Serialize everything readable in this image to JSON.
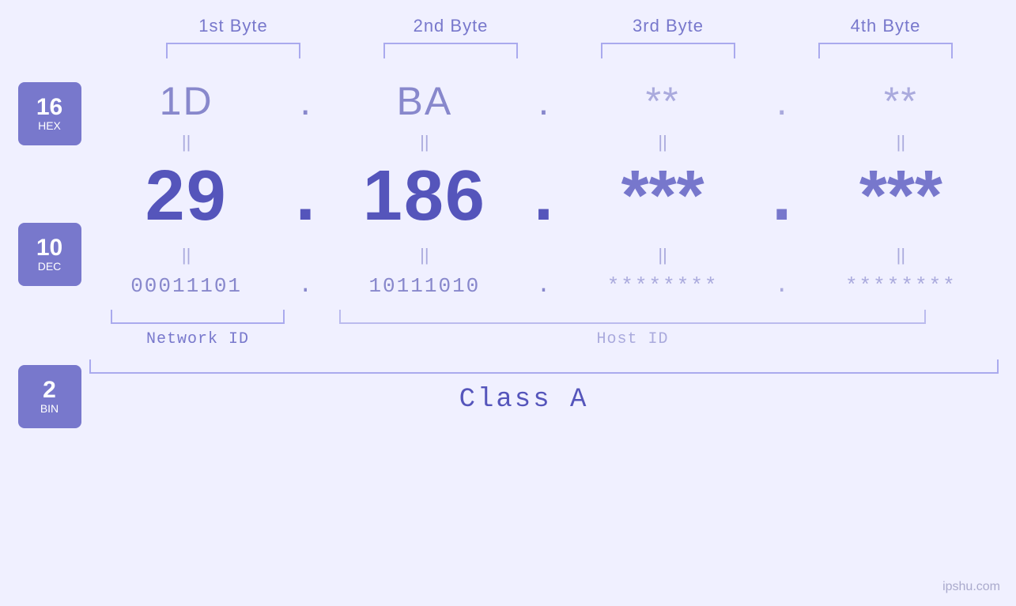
{
  "header": {
    "byte_labels": [
      "1st Byte",
      "2nd Byte",
      "3rd Byte",
      "4th Byte"
    ]
  },
  "bases": [
    {
      "num": "16",
      "label": "HEX"
    },
    {
      "num": "10",
      "label": "DEC"
    },
    {
      "num": "2",
      "label": "BIN"
    }
  ],
  "bytes": [
    {
      "hex": "1D",
      "dec": "29",
      "bin": "00011101",
      "masked": false
    },
    {
      "hex": "BA",
      "dec": "186",
      "bin": "10111010",
      "masked": false
    },
    {
      "hex": "**",
      "dec": "***",
      "bin": "********",
      "masked": true
    },
    {
      "hex": "**",
      "dec": "***",
      "bin": "********",
      "masked": true
    }
  ],
  "labels": {
    "network_id": "Network ID",
    "host_id": "Host ID",
    "class": "Class A"
  },
  "watermark": "ipshu.com"
}
